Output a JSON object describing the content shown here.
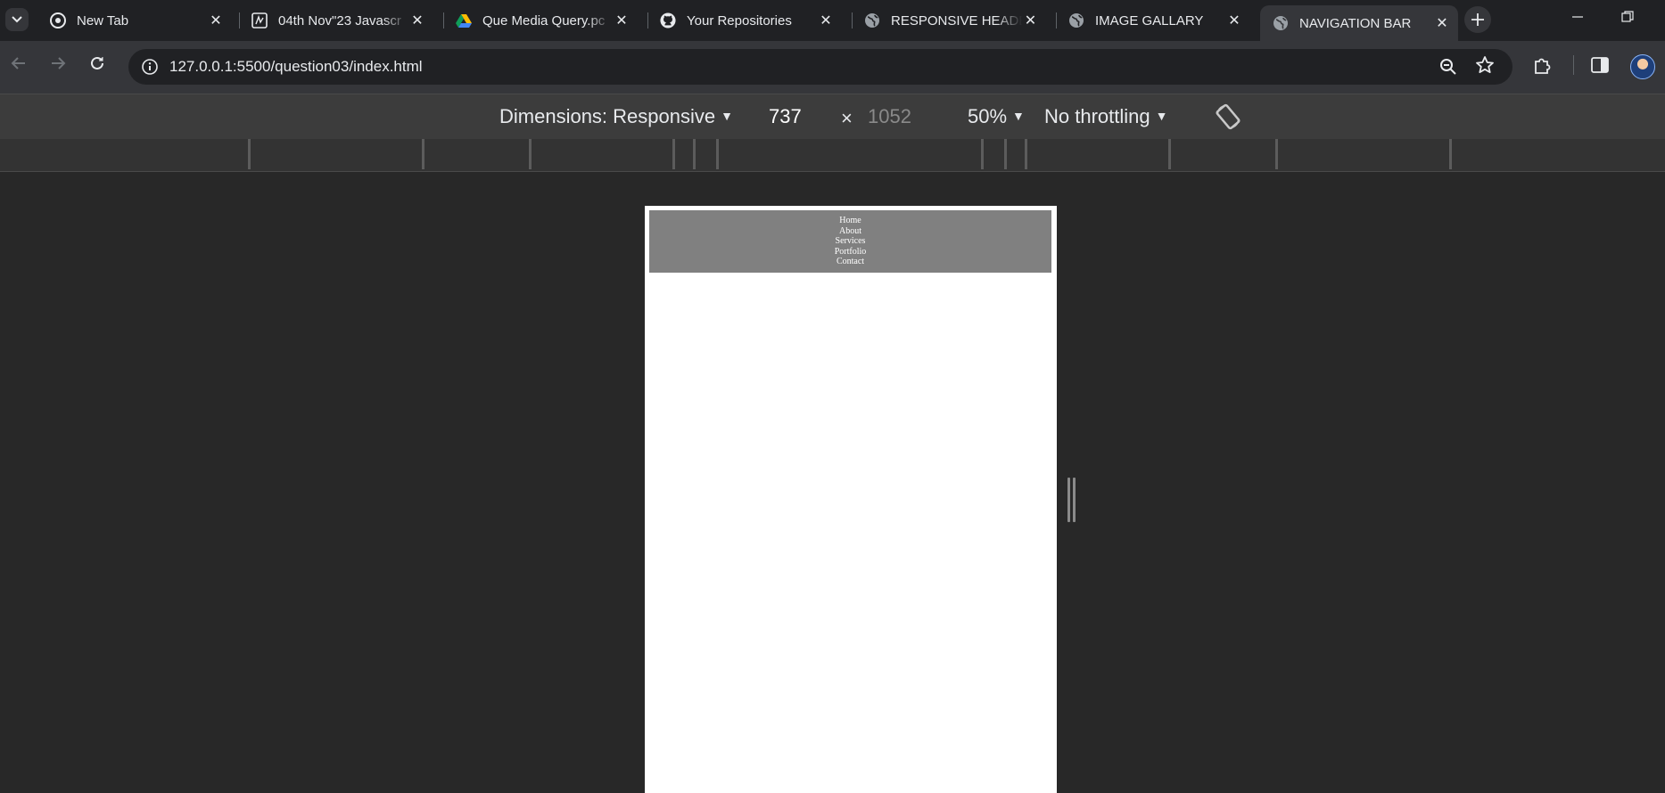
{
  "tabs": [
    {
      "title": "New Tab",
      "icon": "chrome-icon"
    },
    {
      "title": "04th Nov\"23 Javascr",
      "icon": "notebook-icon"
    },
    {
      "title": "Que Media Query.pc",
      "icon": "google-drive-icon"
    },
    {
      "title": "Your Repositories",
      "icon": "github-icon"
    },
    {
      "title": "RESPONSIVE HEADE",
      "icon": "globe-icon"
    },
    {
      "title": "IMAGE GALLARY",
      "icon": "globe-icon"
    },
    {
      "title": "NAVIGATION BAR",
      "icon": "globe-icon",
      "active": true
    }
  ],
  "address_bar": {
    "url": "127.0.0.1:5500/question03/index.html"
  },
  "device_toolbar": {
    "dimensions_label": "Dimensions: Responsive",
    "width": "737",
    "times": "×",
    "height": "1052",
    "zoom": "50%",
    "throttling": "No throttling"
  },
  "site": {
    "nav_links": [
      "Home",
      "About",
      "Services",
      "Portfolio",
      "Contact"
    ],
    "nav_bg": "#808080",
    "nav_text_color": "#ffffff"
  },
  "colors": {
    "chrome_dark": "#202124",
    "toolbar": "#35363a",
    "devtools_bg": "#282828"
  }
}
